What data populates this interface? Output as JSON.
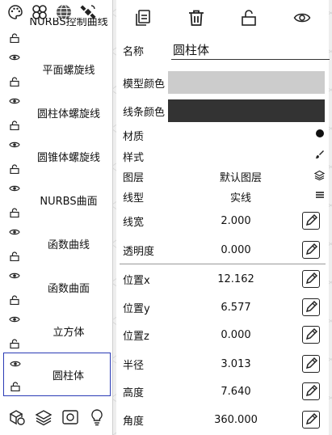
{
  "left_panel": {
    "top_icons": [
      "palette-icon",
      "clover-icon",
      "globe-icon",
      "satellite-icon"
    ],
    "items": [
      {
        "label": "NURBS控制曲线",
        "selected": false
      },
      {
        "label": "平面螺旋线",
        "selected": false
      },
      {
        "label": "圆柱体螺旋线",
        "selected": false
      },
      {
        "label": "圆锥体螺旋线",
        "selected": false
      },
      {
        "label": "NURBS曲面",
        "selected": false
      },
      {
        "label": "函数曲线",
        "selected": false
      },
      {
        "label": "函数曲面",
        "selected": false
      },
      {
        "label": "立方体",
        "selected": false
      },
      {
        "label": "圆柱体",
        "selected": true
      }
    ],
    "bottom_icons": [
      "shapes-icon",
      "layers-icon",
      "camera-icon",
      "bulb-icon"
    ]
  },
  "toolbar": {
    "icons": [
      "copy-icon",
      "trash-icon",
      "lock-open-icon",
      "eye-icon"
    ]
  },
  "properties": {
    "name_label": "名称",
    "name_value": "圆柱体",
    "model_color_label": "模型颜色",
    "model_color": "#cccccc",
    "line_color_label": "线条颜色",
    "line_color": "#333333",
    "material_label": "材质",
    "style_label": "样式",
    "layer_label": "图层",
    "layer_value": "默认图层",
    "linetype_label": "线型",
    "linetype_value": "实线",
    "linewidth_label": "线宽",
    "linewidth_value": "2.000",
    "opacity_label": "透明度",
    "opacity_value": "0.000",
    "pos_x_label": "位置x",
    "pos_x_value": "12.162",
    "pos_y_label": "位置y",
    "pos_y_value": "6.577",
    "pos_z_label": "位置z",
    "pos_z_value": "0.000",
    "radius_label": "半径",
    "radius_value": "3.013",
    "height_label": "高度",
    "height_value": "7.640",
    "angle_label": "角度",
    "angle_value": "360.000"
  }
}
